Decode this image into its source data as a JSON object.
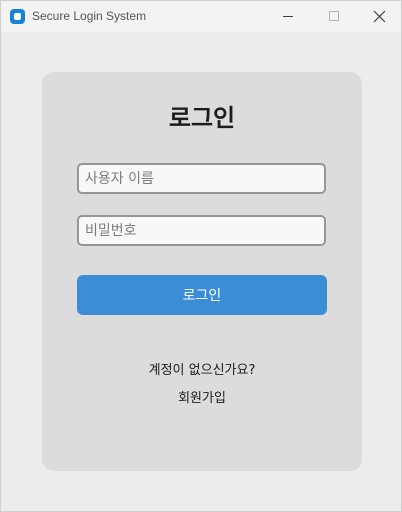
{
  "window": {
    "title": "Secure Login System"
  },
  "login": {
    "heading": "로그인",
    "username_placeholder": "사용자 이름",
    "password_placeholder": "비밀번호",
    "login_button": "로그인",
    "no_account_text": "계정이 없으신가요?",
    "signup_link": "회원가입"
  },
  "colors": {
    "accent": "#3b8ed6",
    "card": "#dcdcdc",
    "background": "#ececec"
  }
}
